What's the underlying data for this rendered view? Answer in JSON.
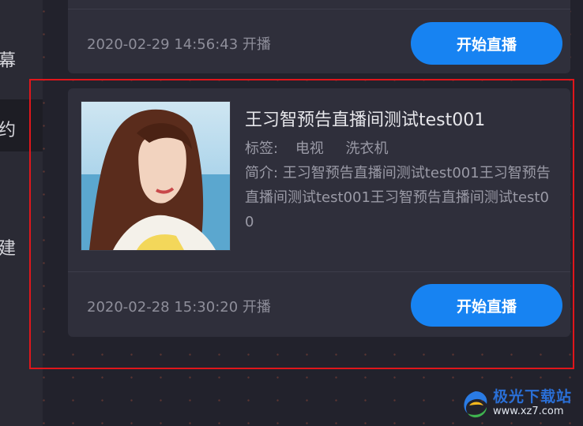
{
  "sidebar": {
    "items": [
      {
        "label": "幕"
      },
      {
        "label": "约"
      },
      {
        "label": "建"
      }
    ]
  },
  "cards": [
    {
      "time": "2020-02-29 14:56:43 开播",
      "button": "开始直播"
    },
    {
      "title": "王习智预告直播间测试test001",
      "tags_label": "标签:",
      "tags": [
        "电视",
        "洗衣机"
      ],
      "desc": "简介: 王习智预告直播间测试test001王习智预告直播间测试test001王习智预告直播间测试test00",
      "time": "2020-02-28 15:30:20 开播",
      "button": "开始直播"
    }
  ],
  "watermark": {
    "name": "极光下载站",
    "url": "www.xz7.com"
  },
  "colors": {
    "accent": "#1783f2",
    "highlight": "#e0161b",
    "card": "#2f2f3b",
    "background": "#22222c"
  }
}
